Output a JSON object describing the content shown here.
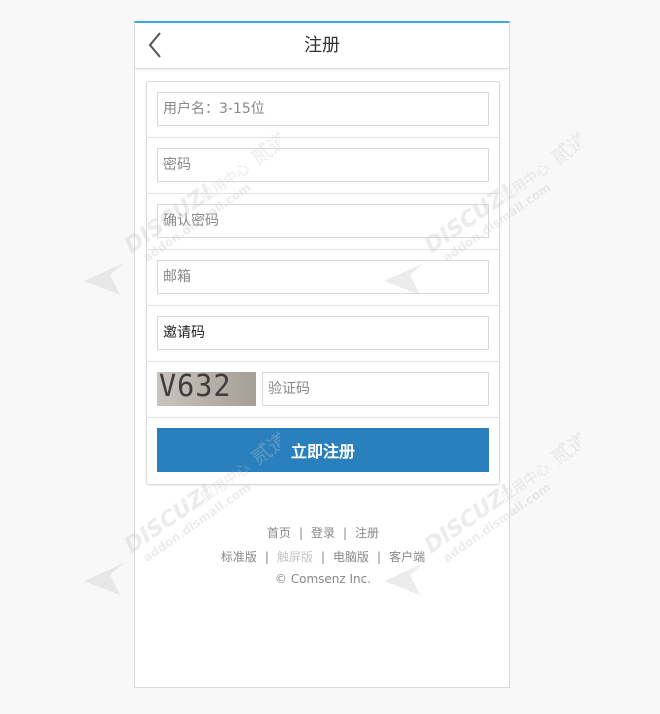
{
  "header": {
    "title": "注册"
  },
  "form": {
    "username_placeholder": "用户名：3-15位",
    "password_placeholder": "密码",
    "confirm_password_placeholder": "确认密码",
    "email_placeholder": "邮箱",
    "invite_code_placeholder": "邀请码",
    "captcha_image_text": "V632",
    "captcha_placeholder": "验证码",
    "submit_label": "立即注册"
  },
  "footer": {
    "links_row1": [
      "首页",
      "登录",
      "注册"
    ],
    "links_row2": [
      "标准版",
      "触屏版",
      "电脑版",
      "客户端"
    ],
    "separator": "|",
    "copyright": "© Comsenz Inc."
  },
  "watermark": {
    "brand": "DISCUZ!",
    "subtitle": "应用中心",
    "url": "addon.dismall.com",
    "mark": "贰道"
  },
  "colors": {
    "accent_top": "#3fa7e0",
    "submit_button": "#2980bc"
  }
}
